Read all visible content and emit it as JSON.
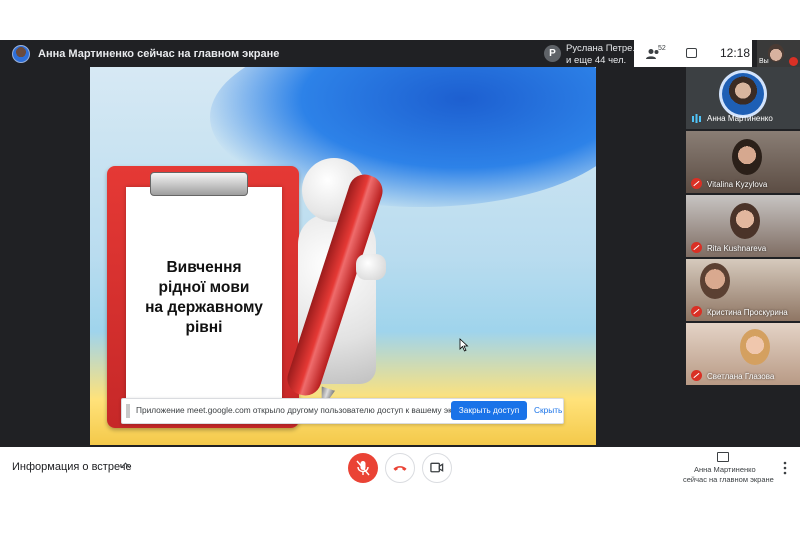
{
  "top_bar": {
    "presenter_status": "Анна Мартиненко сейчас на главном экране",
    "presenter_chip_initial": "Р",
    "presenter_chip_name": "Руслана Петре...",
    "presenter_chip_more": "и еще 44 чел.",
    "participants_count": "52",
    "time": "12:18",
    "self_label": "Вы"
  },
  "slide": {
    "title_line1": "Вивчення",
    "title_line2": "рідної мови",
    "title_line3": "на державному",
    "title_line4": "рівні"
  },
  "notification": {
    "text": "Приложение meet.google.com открыло другому пользователю доступ к вашему экрану",
    "stop_button": "Закрыть доступ",
    "hide_link": "Скрыть"
  },
  "participants": [
    {
      "name": "Анна Мартиненко"
    },
    {
      "name": "Vitalina Kyzylova"
    },
    {
      "name": "Rita Kushnareva"
    },
    {
      "name": "Кристина Проскурина"
    },
    {
      "name": "Светлана Глазова"
    }
  ],
  "bottom_bar": {
    "meeting_info": "Информация о встрече",
    "presenting_line1": "Анна Мартиненко",
    "presenting_line2": "сейчас на главном экране"
  },
  "colors": {
    "accent": "#1a73e8",
    "danger": "#ea4335",
    "dark_bg": "#202124"
  },
  "icons": [
    "people-icon",
    "chat-icon",
    "mic-off-icon",
    "hang-up-icon",
    "camera-icon",
    "present-icon",
    "more-vert-icon",
    "chevron-up-icon",
    "audio-wave-icon",
    "cursor-icon"
  ]
}
